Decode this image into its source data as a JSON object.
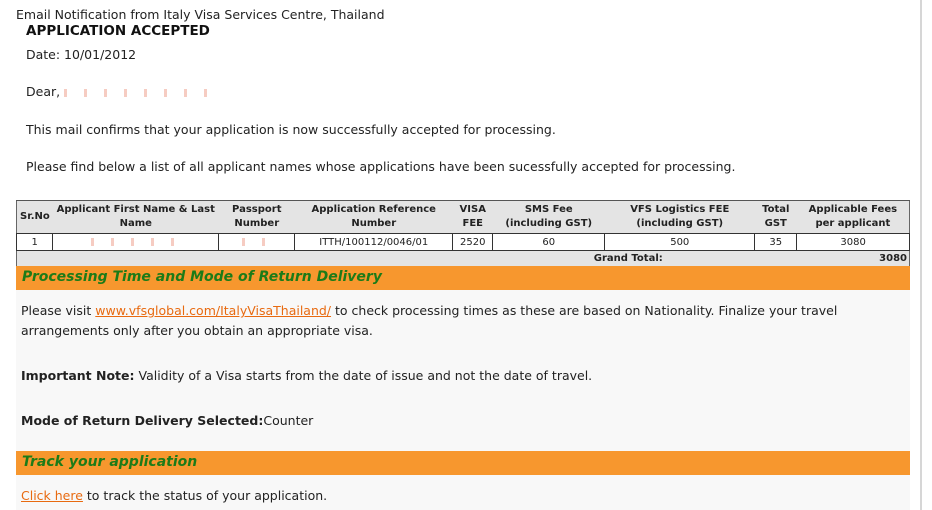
{
  "email": {
    "notification_title": "Email Notification from Italy Visa Services Centre, Thailand",
    "heading": "APPLICATION ACCEPTED",
    "date_line": "Date: 10/01/2012",
    "greeting": "Dear,",
    "paragraph1": "This mail confirms that your application is now successfully accepted for processing.",
    "paragraph2": "Please find below a list of all applicant names whose applications have been sucessfully accepted for processing."
  },
  "table": {
    "headers": [
      "Sr.No",
      "Applicant First Name & Last Name",
      "Passport Number",
      "Application Reference Number",
      "VISA FEE",
      "SMS Fee (including GST)",
      "VFS Logistics FEE (including GST)",
      "Total GST",
      "Applicable Fees per applicant"
    ],
    "rows": [
      {
        "sr": "1",
        "name": "",
        "passport": "",
        "reference": "ITTH/100112/0046/01",
        "visa_fee": "2520",
        "sms_fee": "60",
        "vfs_fee": "500",
        "total_gst": "35",
        "fees": "3080"
      }
    ],
    "grand_total_label": "Grand Total:",
    "grand_total_value": "3080"
  },
  "processing": {
    "heading": "Processing Time and Mode of Return Delivery",
    "visit_prefix": "Please visit ",
    "visit_link": "www.vfsglobal.com/ItalyVisaThailand/",
    "visit_suffix": " to check processing times as these are based on Nationality. Finalize your travel arrangements only after you obtain an appropriate visa.",
    "note_label": "Important Note:",
    "note_text": " Validity of a Visa starts from the date of issue and not the date of travel.",
    "mode_label": "Mode of Return Delivery Selected:",
    "mode_value": "Counter"
  },
  "track": {
    "heading": "Track your application",
    "link_text": "Click here",
    "suffix": " to track the status of your application."
  },
  "colors": {
    "section_header_bg": "#f7972e",
    "section_header_text": "#1c7b18",
    "link": "#e86a10"
  }
}
